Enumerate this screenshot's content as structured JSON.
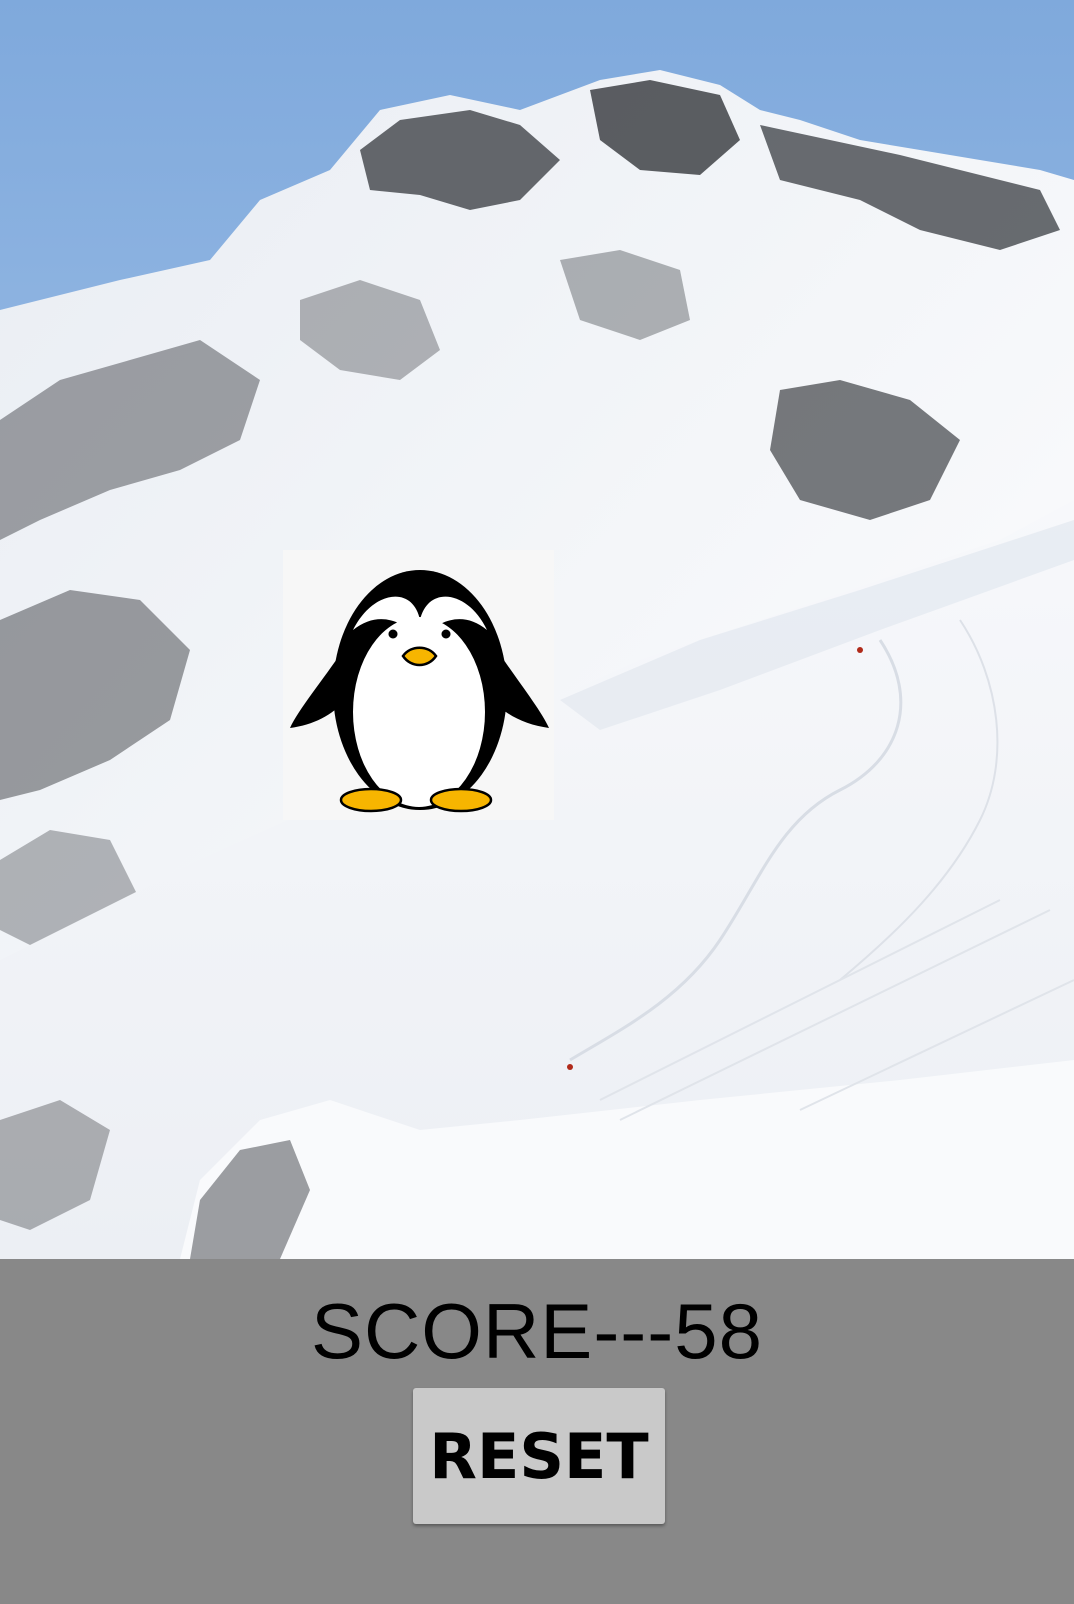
{
  "game": {
    "background": "snowy-mountain-scene",
    "sprite": "penguin-icon"
  },
  "hud": {
    "score_text": "SCORE---58"
  },
  "controls": {
    "reset_label": "RESET"
  },
  "colors": {
    "sky": "#8fb8e6",
    "snow": "#f4f6f9",
    "rock": "#3f4247",
    "panel": "#888888",
    "button": "#c9c9c9",
    "penguin_beak": "#f7b500"
  }
}
